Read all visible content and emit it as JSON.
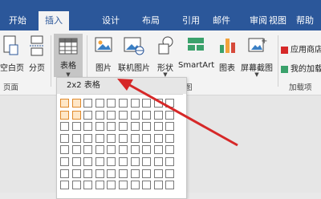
{
  "tabs": [
    "开始",
    "插入",
    "设计",
    "布局",
    "引用",
    "邮件",
    "审阅",
    "视图",
    "帮助"
  ],
  "active_tab": "插入",
  "ribbon": {
    "blank_page": "空白页",
    "page_break": "分页",
    "table": "表格",
    "picture": "图片",
    "online_picture": "联机图片",
    "shapes": "形状",
    "smartart": "SmartArt",
    "chart": "图表",
    "screenshot": "屏幕截图",
    "app_store": "应用商店",
    "my_addins": "我的加载项",
    "group_pages": "页面",
    "group_addins": "加载项",
    "group_illustrations_tail": "图"
  },
  "table_dropdown": {
    "header": "2x2 表格",
    "rows": 8,
    "cols": 10,
    "selected_rows": 2,
    "selected_cols": 2
  },
  "colors": {
    "ribbon_blue": "#2b579a",
    "highlight_orange": "#e08a2c",
    "arrow_red": "#d62828"
  }
}
